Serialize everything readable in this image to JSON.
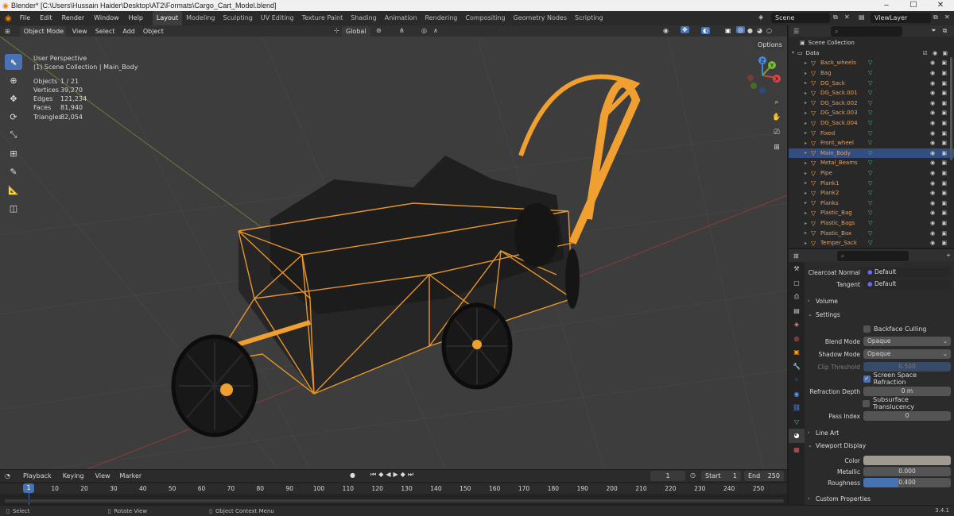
{
  "window": {
    "title": "Blender* [C:\\Users\\Hussain Haider\\Desktop\\AT2\\Formats\\Cargo_Cart_Model.blend]",
    "min": "–",
    "max": "☐",
    "close": "✕"
  },
  "menubar": {
    "items": [
      "File",
      "Edit",
      "Render",
      "Window",
      "Help"
    ]
  },
  "workspaces": [
    "Layout",
    "Modeling",
    "Sculpting",
    "UV Editing",
    "Texture Paint",
    "Shading",
    "Animation",
    "Rendering",
    "Compositing",
    "Geometry Nodes",
    "Scripting"
  ],
  "scene": {
    "name": "Scene",
    "view_layer": "ViewLayer"
  },
  "viewport_header": {
    "mode": "Object Mode",
    "menus": [
      "View",
      "Select",
      "Add",
      "Object"
    ],
    "orientation": "Global",
    "options": "Options"
  },
  "viewport": {
    "perspective": "User Perspective",
    "collection": "(1) Scene Collection | Main_Body",
    "stats": [
      {
        "k": "Objects",
        "v": "1 / 21"
      },
      {
        "k": "Vertices",
        "v": "39,270"
      },
      {
        "k": "Edges",
        "v": "121,234"
      },
      {
        "k": "Faces",
        "v": "81,940"
      },
      {
        "k": "Triangles",
        "v": "82,054"
      }
    ],
    "axes": {
      "x": "X",
      "y": "Y",
      "z": "Z"
    }
  },
  "outliner": {
    "root": "Scene Collection",
    "collection": "Data",
    "items": [
      {
        "name": "Back_wheels",
        "selected": false
      },
      {
        "name": "Bag",
        "selected": false
      },
      {
        "name": "DG_Sack",
        "selected": false
      },
      {
        "name": "DG_Sack.001",
        "selected": false
      },
      {
        "name": "DG_Sack.002",
        "selected": false
      },
      {
        "name": "DG_Sack.003",
        "selected": false
      },
      {
        "name": "DG_Sack.004",
        "selected": false
      },
      {
        "name": "Fixed",
        "selected": false
      },
      {
        "name": "Front_wheel",
        "selected": false
      },
      {
        "name": "Main_Body",
        "selected": true
      },
      {
        "name": "Metal_Beams",
        "selected": false
      },
      {
        "name": "Pipe",
        "selected": false
      },
      {
        "name": "Plank1",
        "selected": false
      },
      {
        "name": "Plank2",
        "selected": false
      },
      {
        "name": "Planks",
        "selected": false
      },
      {
        "name": "Plastic_Bag",
        "selected": false
      },
      {
        "name": "Plastic_Bags",
        "selected": false
      },
      {
        "name": "Plastic_Box",
        "selected": false
      },
      {
        "name": "Temper_Sack",
        "selected": false
      }
    ]
  },
  "properties": {
    "clearcoat_normal_label": "Clearcoat Normal",
    "clearcoat_normal_value": "Default",
    "tangent_label": "Tangent",
    "tangent_value": "Default",
    "volume": "Volume",
    "settings": "Settings",
    "backface_culling": "Backface Culling",
    "blend_mode_label": "Blend Mode",
    "blend_mode_value": "Opaque",
    "shadow_mode_label": "Shadow Mode",
    "shadow_mode_value": "Opaque",
    "clip_threshold_label": "Clip Threshold",
    "clip_threshold_value": "0.500",
    "screen_space_refraction": "Screen Space Refraction",
    "refraction_depth_label": "Refraction Depth",
    "refraction_depth_value": "0 m",
    "subsurface_translucency": "Subsurface Translucency",
    "pass_index_label": "Pass Index",
    "pass_index_value": "0",
    "line_art": "Line Art",
    "viewport_display": "Viewport Display",
    "color_label": "Color",
    "color_value": "#a09a93",
    "metallic_label": "Metallic",
    "metallic_value": "0.000",
    "roughness_label": "Roughness",
    "roughness_value": "0.400",
    "roughness_fraction": 0.4,
    "custom_properties": "Custom Properties"
  },
  "timeline": {
    "menus": [
      "Playback",
      "Keying",
      "View",
      "Marker"
    ],
    "current_frame": "1",
    "start_label": "Start",
    "start_value": "1",
    "end_label": "End",
    "end_value": "250",
    "ticks": [
      "1",
      "10",
      "20",
      "30",
      "40",
      "50",
      "60",
      "70",
      "80",
      "90",
      "100",
      "110",
      "120",
      "130",
      "140",
      "150",
      "160",
      "170",
      "180",
      "190",
      "200",
      "210",
      "220",
      "230",
      "240",
      "250"
    ]
  },
  "statusbar": {
    "select": "Select",
    "rotate": "Rotate View",
    "context": "Object Context Menu",
    "version": "3.4.1"
  },
  "colors": {
    "accent": "#4772b3",
    "wire_selected": "#f0a030",
    "selection_row": "#334d80"
  }
}
